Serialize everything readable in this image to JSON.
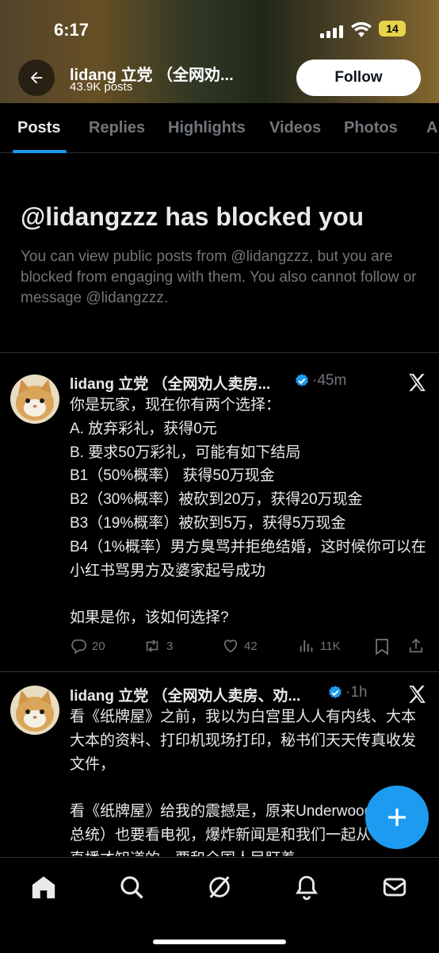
{
  "status_bar": {
    "time": "6:17",
    "battery": "14"
  },
  "header": {
    "name": "lidang 立党 （全网劝...",
    "posts_count": "43.9K posts",
    "follow_label": "Follow"
  },
  "tabs": [
    {
      "label": "Posts"
    },
    {
      "label": "Replies"
    },
    {
      "label": "Highlights"
    },
    {
      "label": "Videos"
    },
    {
      "label": "Photos"
    },
    {
      "label": "A"
    }
  ],
  "blocked": {
    "title": "@lidangzzz has blocked you",
    "message": "You can view public posts from @lidangzzz, but you are blocked from engaging with them. You also cannot follow or message @lidangzzz."
  },
  "posts": [
    {
      "author": "lidang 立党 （全网劝人卖房...",
      "time": "·45m",
      "body": "你是玩家，现在你有两个选择：\nA. 放弃彩礼，获得0元\nB. 要求50万彩礼，可能有如下结局\nB1（50%概率） 获得50万现金\nB2（30%概率）被砍到20万，获得20万现金\nB3（19%概率）被砍到5万，获得5万现金\nB4（1%概率）男方臭骂并拒绝结婚，这时候你可以在小红书骂男方及婆家起号成功\n\n如果是你，该如何选择?",
      "replies": "20",
      "reposts": "3",
      "likes": "42",
      "views": "11K"
    },
    {
      "author": "lidang 立党 （全网劝人卖房、劝...",
      "time": "·1h",
      "body": "看《纸牌屋》之前，我以为白宫里人人有内线、大本大本的资料、打印机现场打印，秘书们天天传真收发文件，\n\n看《纸牌屋》给我的震撼是，原来Underwood（美国总统）也要看电视，爆炸新闻是和我们一起从CNN看直播才知道的，要和全国人民盯着"
    }
  ],
  "colors": {
    "accent": "#1d9bf0",
    "background": "#000000",
    "text": "#e7e9ea",
    "muted": "#71767b"
  },
  "icons": [
    "back-arrow-icon",
    "verified-badge-icon",
    "x-logo-icon",
    "reply-icon",
    "repost-icon",
    "like-icon",
    "views-icon",
    "bookmark-icon",
    "share-icon",
    "compose-plus-icon",
    "home-icon",
    "search-icon",
    "grok-icon",
    "notifications-icon",
    "messages-icon"
  ]
}
